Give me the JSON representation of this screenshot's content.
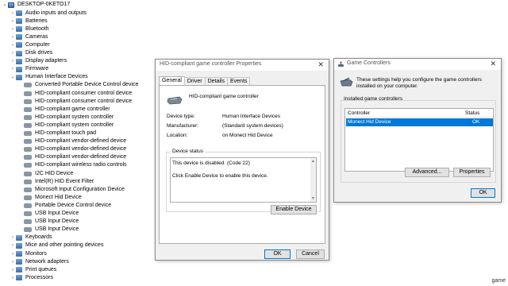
{
  "device_manager": {
    "root": "DESKTOP-0KETO17",
    "items": [
      {
        "label": "Audio inputs and outputs",
        "chevron": "›"
      },
      {
        "label": "Batteries",
        "chevron": "›"
      },
      {
        "label": "Bluetooth",
        "chevron": "›"
      },
      {
        "label": "Cameras",
        "chevron": "›"
      },
      {
        "label": "Computer",
        "chevron": "›"
      },
      {
        "label": "Disk drives",
        "chevron": "›"
      },
      {
        "label": "Display adapters",
        "chevron": "›"
      },
      {
        "label": "Firmware",
        "chevron": "›"
      },
      {
        "label": "Human Interface Devices",
        "chevron": "⌄"
      }
    ],
    "hid_children": [
      "Converted Portable Device Control device",
      "HID-compliant consumer control device",
      "HID-compliant consumer control device",
      "HID-compliant game controller",
      "HID-compliant system controller",
      "HID-compliant system controller",
      "HID-compliant touch pad",
      "HID-compliant vendor-defined device",
      "HID-compliant vendor-defined device",
      "HID-compliant vendor-defined device",
      "HID-compliant wireless radio controls",
      "I2C HID Device",
      "Intel(R) HID Event Filter",
      "Microsoft Input Configuration Device",
      "Monect Hid Device",
      "Portable Device Control device",
      "USB Input Device",
      "USB Input Device",
      "USB Input Device"
    ],
    "after_items": [
      {
        "label": "Keyboards",
        "chevron": "›"
      },
      {
        "label": "Mice and other pointing devices",
        "chevron": "›"
      },
      {
        "label": "Monitors",
        "chevron": "›"
      },
      {
        "label": "Network adapters",
        "chevron": "›"
      },
      {
        "label": "Print queues",
        "chevron": "›"
      },
      {
        "label": "Processors",
        "chevron": "›"
      }
    ]
  },
  "properties_dialog": {
    "title": "HID-compliant game controller Properties",
    "close": "✕",
    "tabs": [
      "General",
      "Driver",
      "Details",
      "Events"
    ],
    "device_name": "HID-compliant game controller",
    "device_type_label": "Device type:",
    "device_type_value": "Human Interface Devices",
    "manufacturer_label": "Manufacturer:",
    "manufacturer_value": "(Standard system devices)",
    "location_label": "Location:",
    "location_value": "on Monect Hid Device",
    "status_group": "Device status",
    "status_line1": "This device is disabled. (Code 22)",
    "status_line2": "Click Enable Device to enable this device.",
    "enable_button": "Enable Device",
    "ok_button": "OK",
    "cancel_button": "Cancel"
  },
  "game_controllers_dialog": {
    "title": "Game Controllers",
    "close": "✕",
    "description": "These settings help you configure the game controllers installed on your computer.",
    "installed_label": "Installed game controllers",
    "col_controller": "Controller",
    "col_status": "Status",
    "rows": [
      {
        "controller": "Monect Hid Device",
        "status": "OK"
      }
    ],
    "advanced_button": "Advanced...",
    "properties_button": "Properties",
    "ok_button": "OK"
  },
  "watermark": "game"
}
